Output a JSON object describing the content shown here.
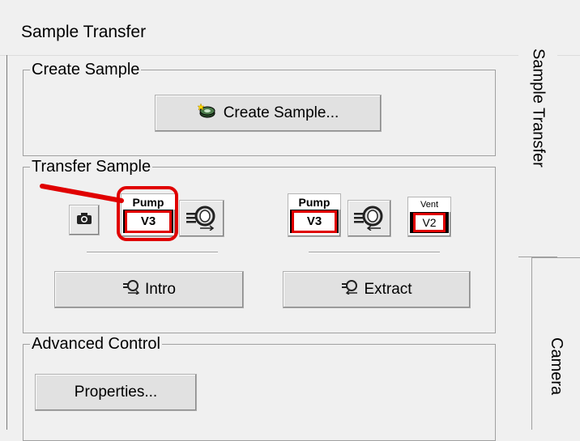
{
  "panel": {
    "title": "Sample Transfer"
  },
  "create_sample": {
    "group_label": "Create Sample",
    "button_label": "Create Sample...",
    "button_icon": "create-sample-icon"
  },
  "transfer_sample": {
    "group_label": "Transfer Sample",
    "camera_icon": "camera-icon",
    "pump_v3_left": {
      "top_label": "Pump",
      "valve_label": "V3"
    },
    "pump_v3_right": {
      "top_label": "Pump",
      "valve_label": "V3"
    },
    "vent_v2": {
      "top_label": "Vent",
      "valve_label": "V2"
    },
    "intro_label": "Intro",
    "extract_label": "Extract",
    "highlight_color": "#e00000"
  },
  "advanced_control": {
    "group_label": "Advanced Control",
    "properties_label": "Properties..."
  },
  "side_tabs": [
    "Sample Transfer",
    "Camera"
  ]
}
